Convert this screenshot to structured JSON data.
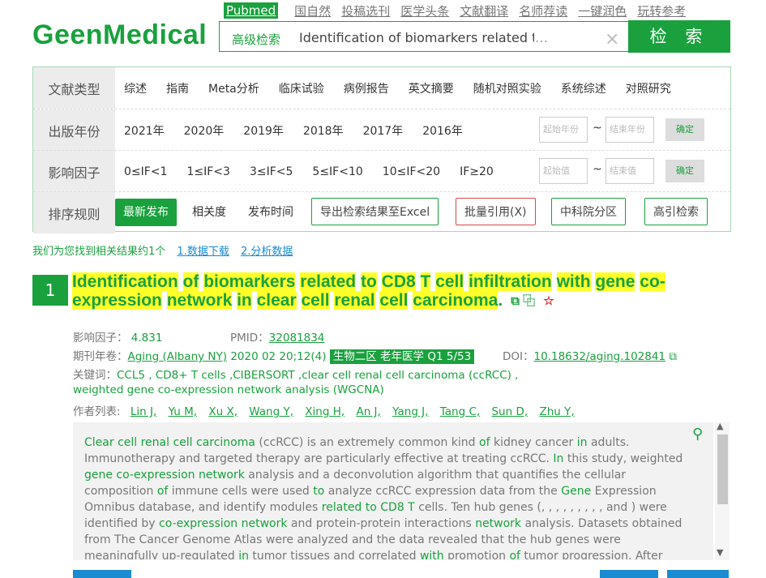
{
  "nav": {
    "links": [
      "Pubmed",
      "国自然",
      "投稿选刊",
      "医学头条",
      "文献翻译",
      "名师荐读",
      "一键润色",
      "玩转参考"
    ]
  },
  "logo": "GeenMedical",
  "search": {
    "advanced_label": "高级检索",
    "query": "Identification of biomarkers related to",
    "ellipsis": "…",
    "clear_icon": "×",
    "button_label": "检 索"
  },
  "filters": {
    "doc_type": {
      "label": "文献类型",
      "options": [
        "综述",
        "指南",
        "Meta分析",
        "临床试验",
        "病例报告",
        "英文摘要",
        "随机对照实验",
        "系统综述",
        "对照研究"
      ]
    },
    "year": {
      "label": "出版年份",
      "options": [
        "2021年",
        "2020年",
        "2019年",
        "2018年",
        "2017年",
        "2016年"
      ],
      "start_placeholder": "起始年份",
      "end_placeholder": "结束年份",
      "tilde": "~",
      "confirm": "确定"
    },
    "impact": {
      "label": "影响因子",
      "options": [
        "0≤IF<1",
        "1≤IF<3",
        "3≤IF<5",
        "5≤IF<10",
        "10≤IF<20",
        "IF≥20"
      ],
      "start_placeholder": "起始值",
      "end_placeholder": "结束值",
      "tilde": "~",
      "confirm": "确定"
    },
    "sort": {
      "label": "排序规则",
      "latest": "最新发布",
      "relevance": "相关度",
      "pubtime": "发布时间",
      "export": "导出检索结果至Excel",
      "batch_cite": "批量引用(X)",
      "cas": "中科院分区",
      "cite_search": "高引检索"
    }
  },
  "results": {
    "found_text": "我们为您找到相关结果约1个",
    "download": "1.数据下载",
    "analysis": "2.分析数据"
  },
  "article": {
    "index": "1",
    "title_words": [
      "Identification",
      "of",
      "biomarkers",
      "related",
      "to",
      "CD8",
      "T",
      "cell",
      "infiltration",
      "with",
      "gene",
      "co-expression",
      "network",
      "in",
      "clear",
      "cell",
      "renal",
      "cell",
      "carcinoma"
    ],
    "title_end": ".",
    "impact_label": "影响因子：",
    "impact_value": "4.831",
    "pmid_label": "PMID：",
    "pmid_value": "32081834",
    "journal_label": "期刊年卷：",
    "journal": "Aging (Albany NY)",
    "volume": "2020 02 20;12(4)",
    "zone_badge": "生物二区 老年医学 Q1 5/53",
    "doi_label": "DOI：",
    "doi": "10.18632/aging.102841",
    "keywords_label": "关键词：",
    "keywords_line1": "CCL5 , CD8+ T cells ,CIBERSORT ,clear cell renal cell carcinoma (ccRCC) ,",
    "keywords_line2": "weighted gene co-expression network analysis (WGCNA)",
    "authors_label": "作者列表:",
    "authors": [
      "Lin J,",
      "Yu M,",
      "Xu X,",
      "Wang Y,",
      "Xing H,",
      "An J,",
      "Yang J,",
      "Tang C,",
      "Sun D,",
      "Zhu Y,"
    ],
    "abstract": [
      {
        "t": "Clear cell renal cell carcinoma",
        "k": true
      },
      {
        "t": " (ccRCC) is an extremely common kind ",
        "k": false
      },
      {
        "t": "of",
        "k": true
      },
      {
        "t": " kidney cancer ",
        "k": false
      },
      {
        "t": "in",
        "k": true
      },
      {
        "t": " adults. Immunotherapy and targeted therapy are particularly effective at treating ccRCC. ",
        "k": false
      },
      {
        "t": "In",
        "k": true
      },
      {
        "t": " this study, weighted ",
        "k": false
      },
      {
        "t": "gene co-expression network",
        "k": true
      },
      {
        "t": " analysis and a deconvolution algorithm that quantifies the cellular composition ",
        "k": false
      },
      {
        "t": "of",
        "k": true
      },
      {
        "t": " immune cells were used ",
        "k": false
      },
      {
        "t": "to",
        "k": true
      },
      {
        "t": " analyze ccRCC expression data from the ",
        "k": false
      },
      {
        "t": "Gene",
        "k": true
      },
      {
        "t": " Expression Omnibus database, and identify modules ",
        "k": false
      },
      {
        "t": "related to CD8 T",
        "k": true
      },
      {
        "t": " cells. Ten hub genes (, , , , , , , , , and ) were identified by ",
        "k": false
      },
      {
        "t": "co-expression network",
        "k": true
      },
      {
        "t": " and protein-protein interactions ",
        "k": false
      },
      {
        "t": "network",
        "k": true
      },
      {
        "t": " analysis. Datasets obtained from The Cancer Genome Atlas were analyzed and the data revealed that the hub genes were meaningfully up-regulated ",
        "k": false
      },
      {
        "t": "in",
        "k": true
      },
      {
        "t": " tumor tissues and correlated ",
        "k": false
      },
      {
        "t": "with",
        "k": true
      },
      {
        "t": " promotion ",
        "k": false
      },
      {
        "t": "of",
        "k": true
      },
      {
        "t": " tumor progression. After Kaplan-Meier analysis and Oncomine meta-analysis, was selected as a",
        "k": false
      }
    ]
  },
  "colors": {
    "brand": "#1aa13e",
    "highlight": "#ffff2a",
    "link": "#1a8bd0"
  }
}
